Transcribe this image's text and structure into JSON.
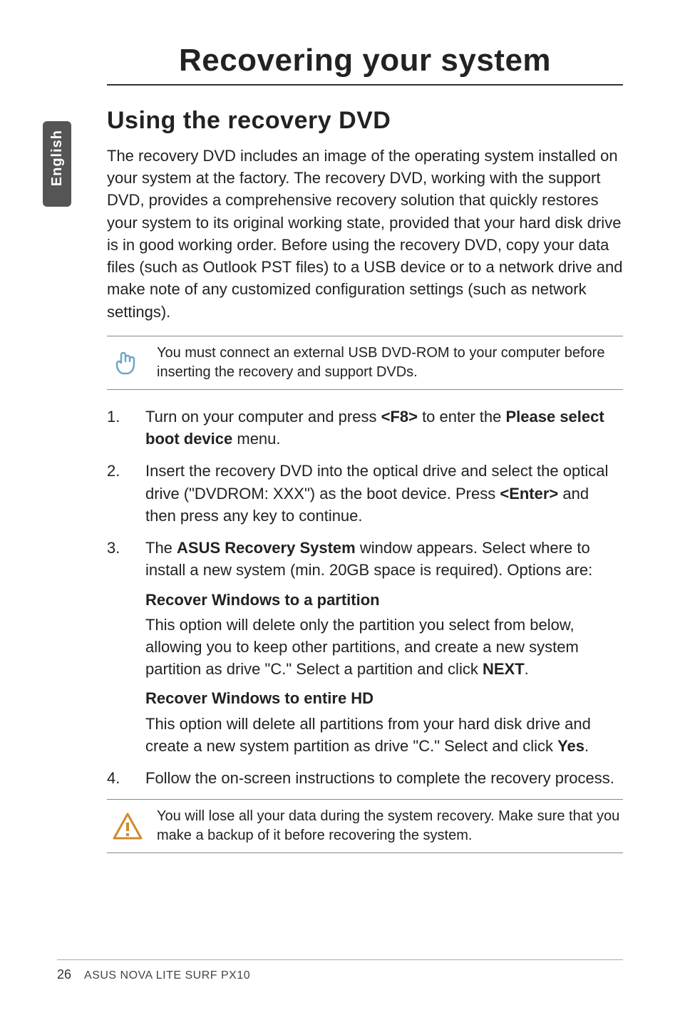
{
  "side_tab": "English",
  "title": "Recovering your system",
  "section_heading": "Using the recovery DVD",
  "intro": "The recovery DVD includes an image of the operating system installed on your system at the factory. The recovery DVD, working with the support DVD, provides a comprehensive recovery solution that quickly restores your system to its original working state, provided that your hard disk drive is in good working order. Before using the recovery DVD, copy your data files (such as Outlook PST files) to a USB device or to a network drive and make note of any customized configuration settings (such as network settings).",
  "note_top": "You must connect an external USB DVD-ROM to your computer before inserting the recovery and support DVDs.",
  "steps": {
    "s1_a": "Turn on your computer and press ",
    "s1_key": "<F8>",
    "s1_b": " to enter the ",
    "s1_menu": "Please select boot device",
    "s1_c": " menu.",
    "s2_a": "Insert the recovery DVD into the optical drive and select the optical drive (\"DVDROM: XXX\") as the boot device. Press ",
    "s2_key": "<Enter>",
    "s2_b": " and then press any key to continue.",
    "s3_a": "The ",
    "s3_win": "ASUS Recovery System",
    "s3_b": " window appears. Select where to install a new system (min. 20GB space is required). Options are:",
    "s3_opt1_head": "Recover Windows to a partition",
    "s3_opt1_body_a": "This option will delete only the partition you select from below, allowing you to keep other partitions, and create a new system partition as drive \"C.\" Select a partition and click ",
    "s3_opt1_next": "NEXT",
    "s3_opt1_body_b": ".",
    "s3_opt2_head": "Recover Windows to entire HD",
    "s3_opt2_body_a": "This option will delete all partitions from your hard disk drive and create a new system partition as drive \"C.\" Select and click ",
    "s3_opt2_yes": "Yes",
    "s3_opt2_body_b": ".",
    "s4": "Follow the on-screen instructions to complete the recovery process."
  },
  "note_bottom": "You will lose all your data during the system recovery. Make sure that you make a backup of it before recovering the system.",
  "footer": {
    "page": "26",
    "title": "ASUS NOVA LITE SURF PX10"
  }
}
